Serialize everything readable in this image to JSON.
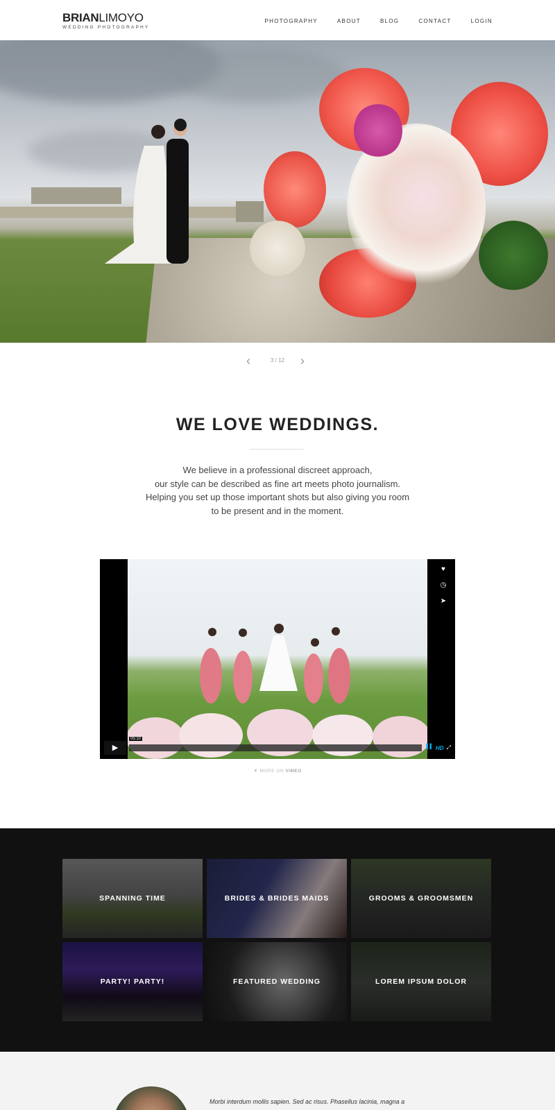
{
  "header": {
    "logo_bold": "BRIAN",
    "logo_light": "LIMOYO",
    "logo_sub": "WEDDING PHOTOGRAPHY",
    "nav": [
      "PHOTOGRAPHY",
      "ABOUT",
      "BLOG",
      "CONTACT",
      "LOGIN"
    ]
  },
  "slider": {
    "counter": "3 / 12",
    "prev_icon": "chevron-left-icon",
    "next_icon": "chevron-right-icon"
  },
  "intro": {
    "title": "WE LOVE WEDDINGS.",
    "lines": [
      "We believe in a professional discreet approach,",
      "our style can be described as fine art meets photo journalism.",
      "Helping you set up those important shots but also giving you room",
      "to be present and in the moment."
    ]
  },
  "video": {
    "time": "05:10",
    "hd_label": "HD",
    "side_icons": [
      "heart-icon",
      "clock-icon",
      "send-icon"
    ],
    "more_prefix": "MORE ON",
    "more_brand": "VIMEO"
  },
  "galleries": [
    {
      "label": "SPANNING TIME"
    },
    {
      "label": "BRIDES & BRIDES MAIDS"
    },
    {
      "label": "GROOMS & GROOMSMEN"
    },
    {
      "label": "PARTY! PARTY!"
    },
    {
      "label": "FEATURED WEDDING"
    },
    {
      "label": "LOREM IPSUM DOLOR"
    }
  ],
  "testimonial": {
    "quote": "Morbi interdum mollis sapien. Sed ac risus. Phasellus lacinia, magna a"
  },
  "colors": {
    "dark_band": "#111111",
    "accent_vimeo": "#00adef"
  }
}
